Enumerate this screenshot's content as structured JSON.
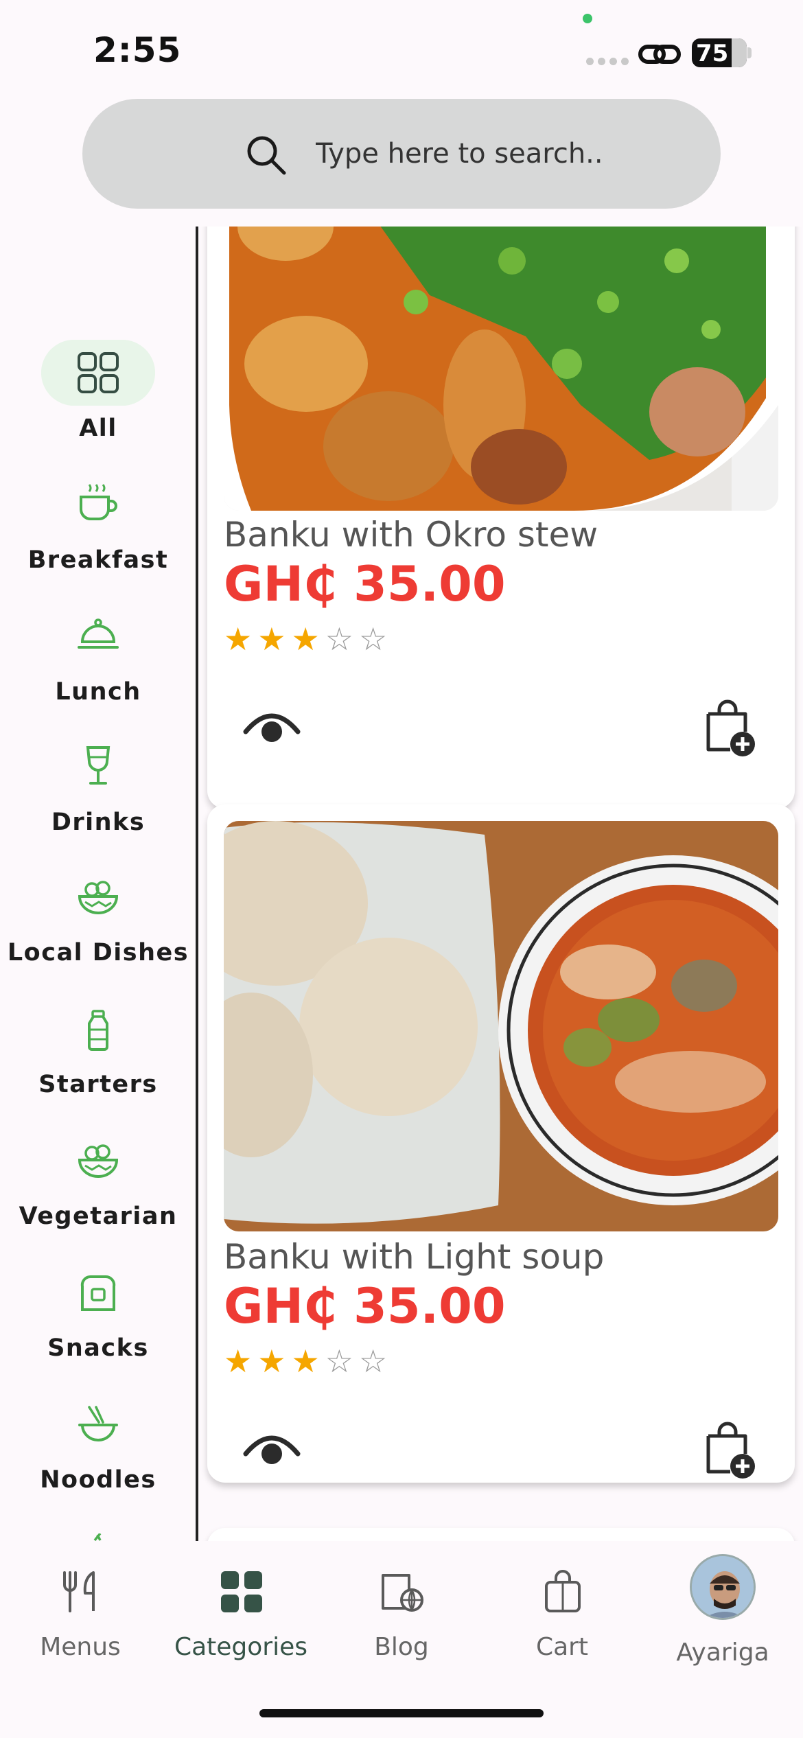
{
  "status_bar": {
    "time": "2:55",
    "battery": "75"
  },
  "search": {
    "placeholder": "Type here to search.."
  },
  "categories": [
    {
      "label": "All",
      "icon": "grid-icon",
      "active": true
    },
    {
      "label": "Breakfast",
      "icon": "coffee-cup-icon"
    },
    {
      "label": "Lunch",
      "icon": "cloche-icon"
    },
    {
      "label": "Drinks",
      "icon": "wine-glass-icon"
    },
    {
      "label": "Local Dishes",
      "icon": "bowl-icon"
    },
    {
      "label": "Starters",
      "icon": "bottle-icon"
    },
    {
      "label": "Vegetarian",
      "icon": "salad-bowl-icon"
    },
    {
      "label": "Snacks",
      "icon": "toast-icon"
    },
    {
      "label": "Noodles",
      "icon": "noodle-bowl-icon"
    }
  ],
  "foods": [
    {
      "title": "Banku with Okro stew",
      "price": "GH₵ 35.00",
      "rating": 3,
      "max_rating": 5
    },
    {
      "title": "Banku with Light soup",
      "price": "GH₵ 35.00",
      "rating": 3,
      "max_rating": 5
    }
  ],
  "tabs": [
    {
      "label": "Menus",
      "icon": "fork-knife-icon"
    },
    {
      "label": "Categories",
      "icon": "grid-filled-icon",
      "active": true
    },
    {
      "label": "Blog",
      "icon": "book-globe-icon"
    },
    {
      "label": "Cart",
      "icon": "shopping-bag-icon"
    },
    {
      "label": "Ayariga",
      "icon": "avatar"
    }
  ],
  "colors": {
    "accent_green": "#4caf50",
    "active_tab": "#365347",
    "price_red": "#ee3b34",
    "star": "#f5a600"
  }
}
